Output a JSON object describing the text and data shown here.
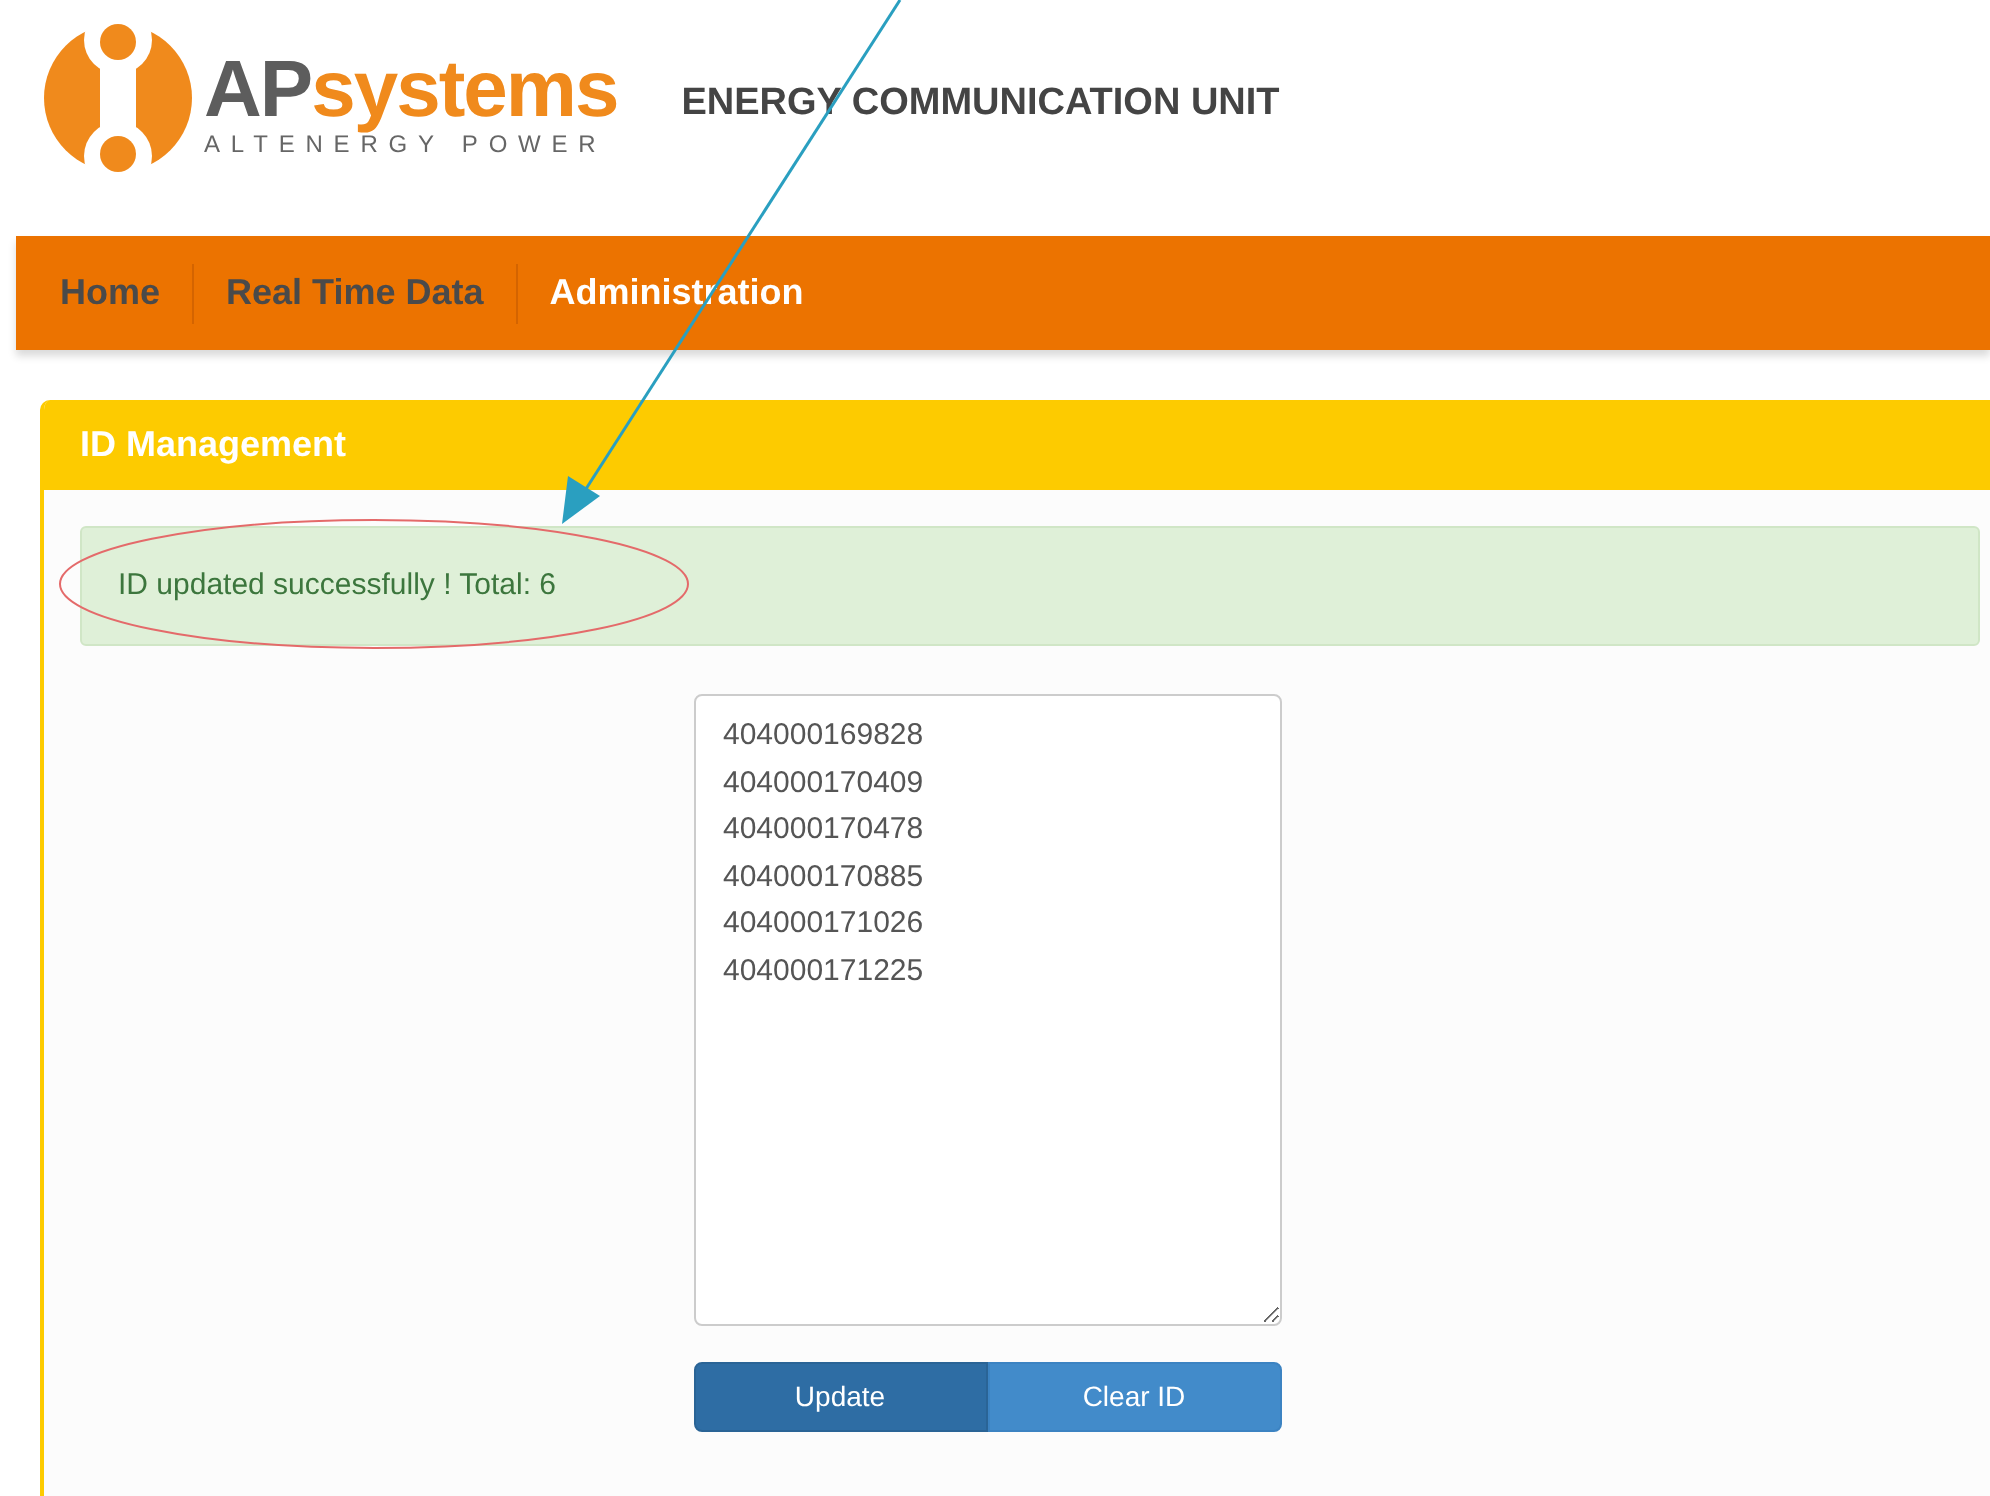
{
  "logo": {
    "brand_dark": "AP",
    "brand_light": "systems",
    "tagline": "ALTENERGY POWER"
  },
  "header": {
    "title": "ENERGY COMMUNICATION UNIT"
  },
  "nav": [
    {
      "label": "Home",
      "selected": false
    },
    {
      "label": "Real Time Data",
      "selected": false
    },
    {
      "label": "Administration",
      "selected": true
    }
  ],
  "panel": {
    "title": "ID Management",
    "alert": "ID updated successfully ! Total: 6",
    "ids": [
      "404000169828",
      "404000170409",
      "404000170478",
      "404000170885",
      "404000171026",
      "404000171225"
    ],
    "buttons": [
      {
        "label": "Update",
        "active": true
      },
      {
        "label": "Clear ID",
        "active": false
      }
    ]
  }
}
